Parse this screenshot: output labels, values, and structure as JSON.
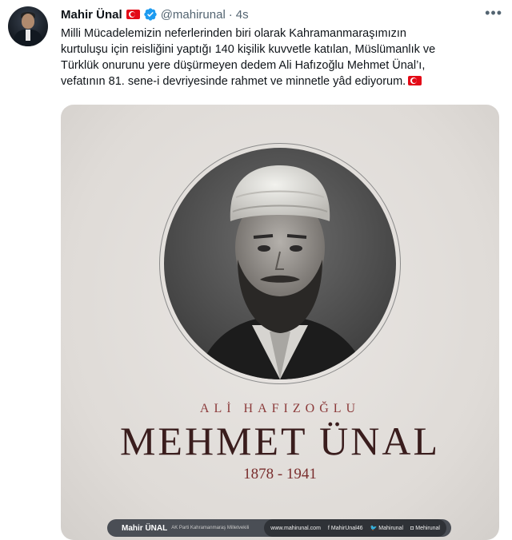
{
  "tweet": {
    "author_name": "Mahir Ünal",
    "handle": "@mahirunal",
    "separator": "·",
    "time": "4s",
    "more_icon": "•••",
    "text_lines": [
      "Milli Mücadelemizin neferlerinden biri olarak Kahramanmaraşımızın",
      "kurtuluşu için reisliğini yaptığı 140 kişilik kuvvetle katılan, Müslümanlık ve",
      "Türklük onurunu yere düşürmeyen dedem Ali Hafızoğlu Mehmet Ünal’ı,",
      "vefatının 81. sene-i devriyesinde rahmet ve minnetle yâd ediyorum."
    ],
    "icons": {
      "name_flag": "turkey-flag-icon",
      "verified": "verified-badge-icon",
      "text_flag": "turkey-flag-icon"
    },
    "colors": {
      "verified_blue": "#1d9bf0",
      "flag_red": "#e30a17",
      "muted": "#536471"
    }
  },
  "card": {
    "pre_name": "ALİ HAFIZOĞLU",
    "main_name": "MEHMET ÜNAL",
    "years": "1878 - 1941",
    "footer": {
      "name": "Mahir ÜNAL",
      "role": "AK Parti Kahramanmaraş Milletvekili",
      "website": "www.mahirunal.com",
      "facebook": "MahirUnal46",
      "twitter": "Mahirunal",
      "instagram": "Mehirunal",
      "facebook_icon": "f",
      "twitter_icon": "🐦",
      "instagram_icon": "◘"
    }
  }
}
